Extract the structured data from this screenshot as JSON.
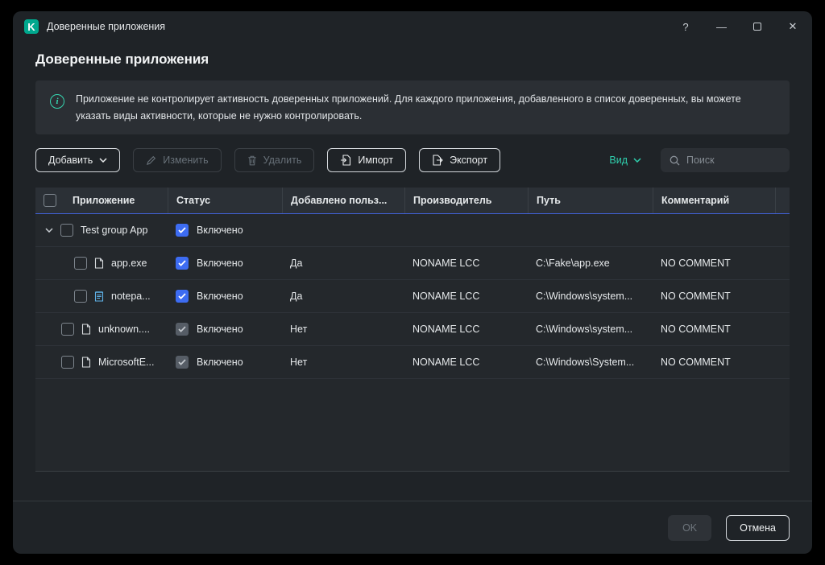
{
  "window": {
    "logo_letter": "K",
    "title": "Доверенные приложения",
    "controls": {
      "help": "?",
      "minimize": "—",
      "close": "✕"
    }
  },
  "page": {
    "title": "Доверенные приложения"
  },
  "banner": {
    "text": "Приложение не контролирует активность доверенных приложений. Для каждого приложения, добавленного в список доверенных, вы можете указать виды активности, которые не нужно контролировать."
  },
  "toolbar": {
    "add": "Добавить",
    "edit": "Изменить",
    "delete": "Удалить",
    "import": "Импорт",
    "export": "Экспорт",
    "view": "Вид",
    "search_placeholder": "Поиск"
  },
  "table": {
    "columns": [
      "Приложение",
      "Статус",
      "Добавлено польз...",
      "Производитель",
      "Путь",
      "Комментарий"
    ],
    "group": {
      "name": "Test group App",
      "status": "Включено"
    },
    "rows": [
      {
        "name": "app.exe",
        "status": "Включено",
        "added": "Да",
        "vendor": "NONAME LCC",
        "path": "C:\\Fake\\app.exe",
        "comment": "NO COMMENT"
      },
      {
        "name": "notepa...",
        "status": "Включено",
        "added": "Да",
        "vendor": "NONAME LCC",
        "path": "C:\\Windows\\system...",
        "comment": "NO COMMENT"
      },
      {
        "name": "unknown....",
        "status": "Включено",
        "added": "Нет",
        "vendor": "NONAME LCC",
        "path": "C:\\Windows\\system...",
        "comment": "NO COMMENT"
      },
      {
        "name": "MicrosoftE...",
        "status": "Включено",
        "added": "Нет",
        "vendor": "NONAME LCC",
        "path": "C:\\Windows\\System...",
        "comment": "NO COMMENT"
      }
    ]
  },
  "footer": {
    "ok": "OK",
    "cancel": "Отмена"
  },
  "colors": {
    "accent_teal": "#2fd0ae",
    "check_blue": "#3d6cf2",
    "check_gray": "#565d66",
    "brand_green": "#00a88e"
  }
}
